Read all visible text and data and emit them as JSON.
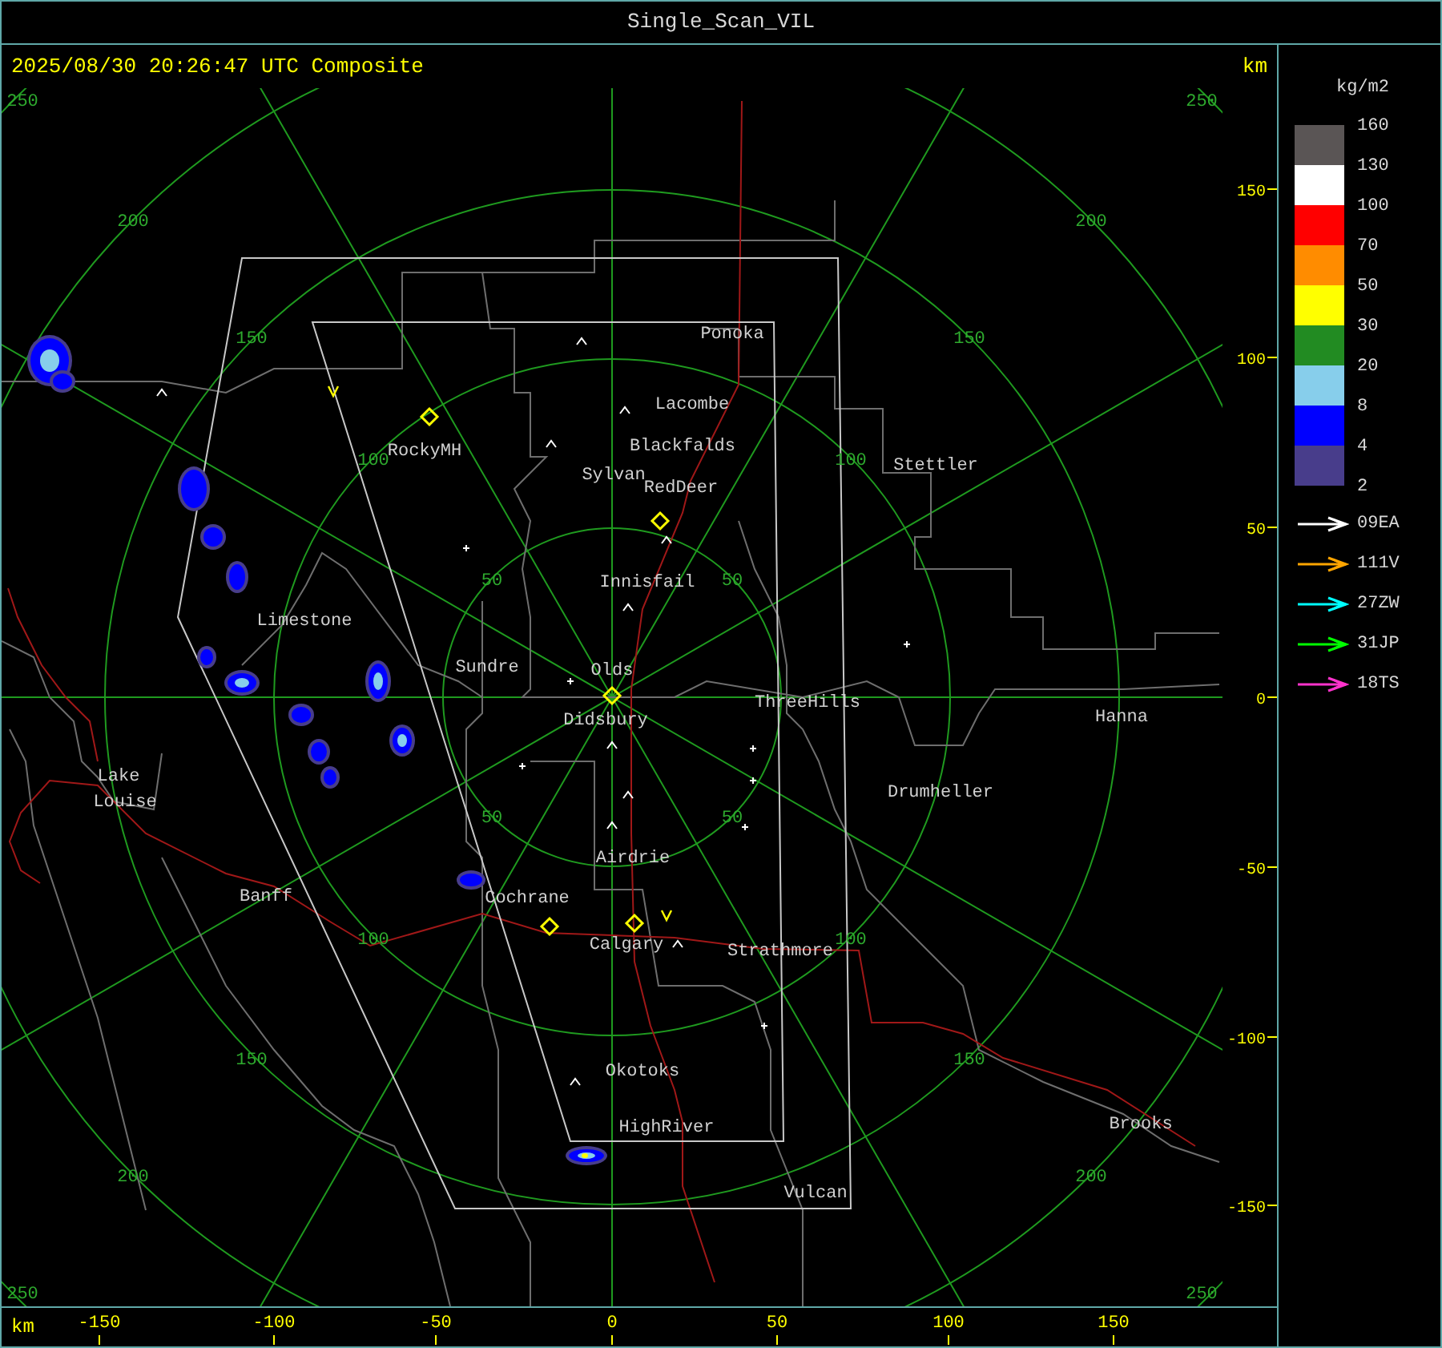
{
  "window": {
    "title": "Single_Scan_VIL"
  },
  "header": {
    "timestamp": "2025/08/30 20:26:47 UTC Composite",
    "unit": "km"
  },
  "map": {
    "ring_labels": [
      "250",
      "250",
      "200",
      "200",
      "150",
      "150",
      "100",
      "100",
      "50",
      "50",
      "50",
      "50",
      "100",
      "100",
      "150",
      "150",
      "200",
      "200",
      "250",
      "250"
    ],
    "places": [
      "Ponoka",
      "Lacombe",
      "Blackfalds",
      "Sylvan",
      "RedDeer",
      "RockyMH",
      "Stettler",
      "Innisfail",
      "Limestone",
      "Sundre",
      "Olds",
      "Didsbury",
      "ThreeHills",
      "Hanna",
      "Lake",
      "Louise",
      "Drumheller",
      "Airdrie",
      "Banff",
      "Cochrane",
      "Calgary",
      "Strathmore",
      "Okotoks",
      "HighRiver",
      "Brooks",
      "Vulcan"
    ]
  },
  "y_axis": {
    "ticks": [
      "150",
      "100",
      "50",
      "0",
      "-50",
      "-100",
      "-150"
    ]
  },
  "x_axis": {
    "unit": "km",
    "ticks": [
      "-150",
      "-100",
      "-50",
      "0",
      "50",
      "100",
      "150"
    ]
  },
  "legend": {
    "unit": "kg/m2",
    "bins": [
      {
        "color": "#5a5555"
      },
      {
        "color": "#ffffff"
      },
      {
        "color": "#ff0000"
      },
      {
        "color": "#ff8c00"
      },
      {
        "color": "#ffff00"
      },
      {
        "color": "#228b22"
      },
      {
        "color": "#87ceeb"
      },
      {
        "color": "#0000ff"
      },
      {
        "color": "#483d8b"
      }
    ],
    "labels": [
      "160",
      "130",
      "100",
      "70",
      "50",
      "30",
      "20",
      "8",
      "4",
      "2"
    ]
  },
  "tracks": [
    {
      "label": "09EA",
      "color": "#ffffff"
    },
    {
      "label": "111V",
      "color": "#ffa500"
    },
    {
      "label": "27ZW",
      "color": "#00ffff"
    },
    {
      "label": "31JP",
      "color": "#00ff00"
    },
    {
      "label": "18TS",
      "color": "#ff33cc"
    }
  ]
}
